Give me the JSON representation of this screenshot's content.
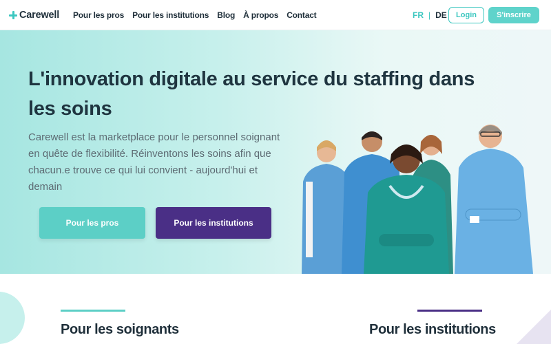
{
  "nav": {
    "logo": "Carewell",
    "items": [
      "Pour les pros",
      "Pour les institutions",
      "Blog",
      "À propos",
      "Contact"
    ],
    "lang_fr": "FR",
    "lang_sep": "|",
    "lang_de": "DE",
    "login": "Login",
    "signup": "S'inscrire"
  },
  "hero": {
    "title": "L'innovation digitale au service du staffing dans les soins",
    "subtitle": "Carewell est la marketplace pour le personnel soignant en quête de flexibilité. Réinventons les soins afin que chacun.e trouve ce qui lui convient - aujourd'hui et demain",
    "cta_pros": "Pour les pros",
    "cta_institutions": "Pour les institutions"
  },
  "section": {
    "left_title": "Pour les soignants",
    "right_title": "Pour les institutions"
  },
  "colors": {
    "brand_teal": "#5ccfc6",
    "brand_purple": "#4a2f86",
    "text_dark": "#1f2f3a"
  }
}
